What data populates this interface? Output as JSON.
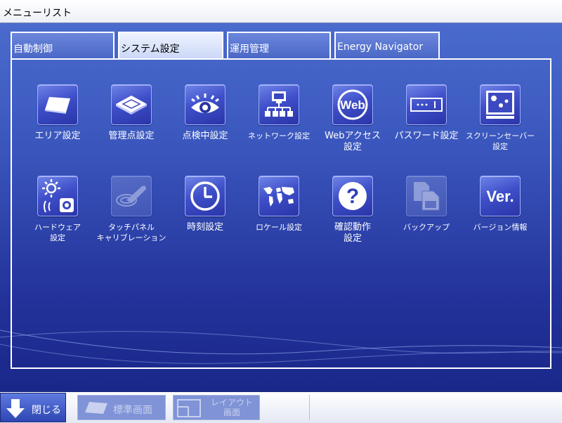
{
  "window": {
    "title": "メニューリスト"
  },
  "tabs": [
    {
      "label": "自動制御",
      "active": false
    },
    {
      "label": "システム設定",
      "active": true
    },
    {
      "label": "運用管理",
      "active": false
    },
    {
      "label": "Energy Navigator",
      "active": false
    }
  ],
  "menu": {
    "row1": [
      {
        "label": "エリア設定",
        "icon": "area-panel-icon"
      },
      {
        "label": "管理点設定",
        "icon": "ceiling-unit-icon"
      },
      {
        "label": "点検中設定",
        "icon": "eye-icon"
      },
      {
        "label": "ネットワーク設定",
        "icon": "network-icon"
      },
      {
        "label": "Webアクセス\n設定",
        "icon": "web-icon"
      },
      {
        "label": "パスワード設定",
        "icon": "password-icon"
      },
      {
        "label": "スクリーンセーバー\n設定",
        "icon": "screensaver-icon"
      }
    ],
    "row2": [
      {
        "label": "ハードウェア\n設定",
        "icon": "hardware-icon"
      },
      {
        "label": "タッチパネル\nキャリブレーション",
        "icon": "touch-panel-icon"
      },
      {
        "label": "時刻設定",
        "icon": "clock-icon"
      },
      {
        "label": "ロケール設定",
        "icon": "world-map-icon"
      },
      {
        "label": "確認動作\n設定",
        "icon": "question-icon"
      },
      {
        "label": "バックアップ",
        "icon": "backup-icon"
      },
      {
        "label": "バージョン情報",
        "icon": "version-icon",
        "icon_text": "Ver."
      }
    ]
  },
  "footer": {
    "close_label": "閉じる",
    "standard_label": "標準画面",
    "layout_label": "レイアウト\n画面"
  },
  "web_icon_text": "Web"
}
